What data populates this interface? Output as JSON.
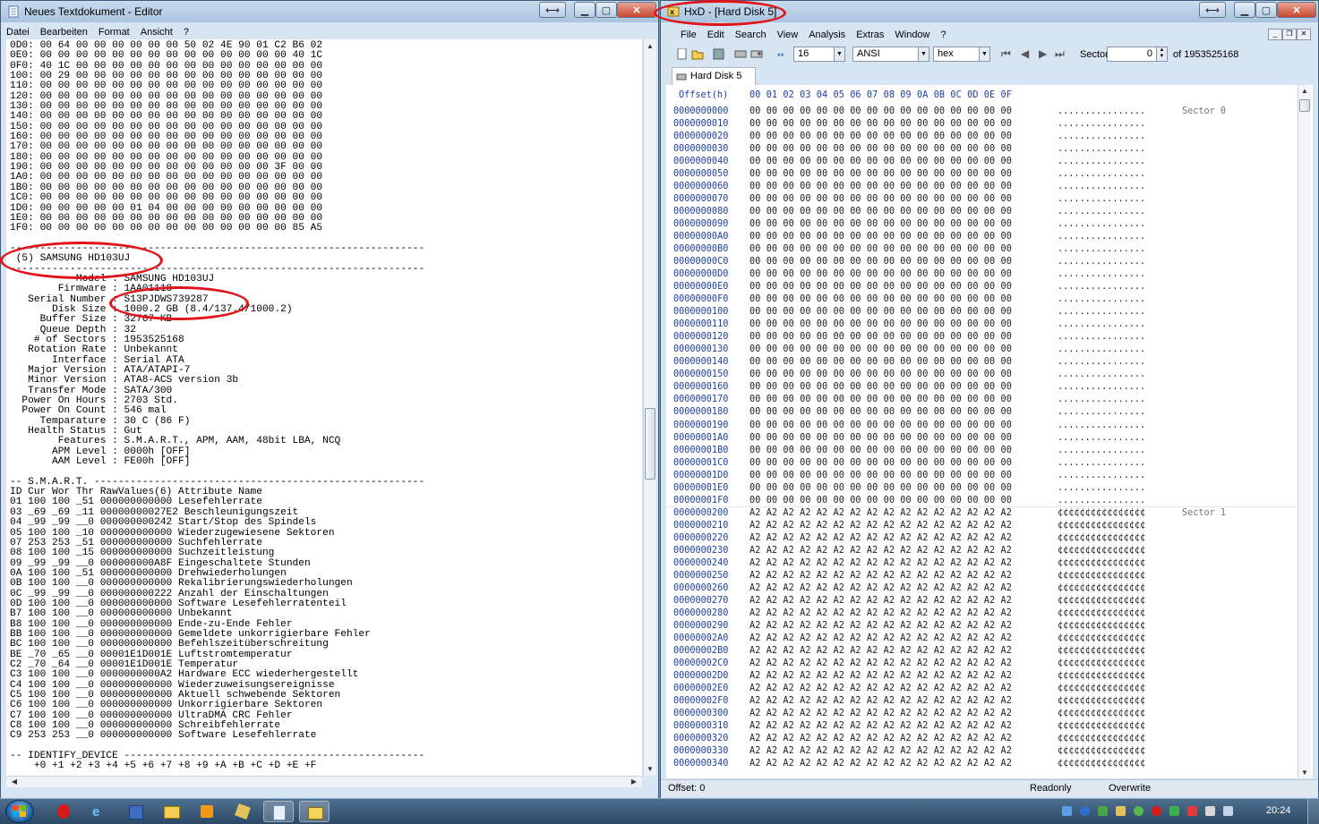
{
  "notepad": {
    "title": "Neues Textdokument - Editor",
    "menu": [
      "Datei",
      "Bearbeiten",
      "Format",
      "Ansicht",
      "?"
    ],
    "content": "0D0: 00 64 00 00 00 00 00 00 50 02 4E 90 01 C2 B6 02\n0E0: 00 00 00 00 00 00 00 00 00 00 00 00 00 00 40 1C\n0F0: 40 1C 00 00 00 00 00 00 00 00 00 00 00 00 00 00\n100: 00 29 00 00 00 00 00 00 00 00 00 00 00 00 00 00\n110: 00 00 00 00 00 00 00 00 00 00 00 00 00 00 00 00\n120: 00 00 00 00 00 00 00 00 00 00 00 00 00 00 00 00\n130: 00 00 00 00 00 00 00 00 00 00 00 00 00 00 00 00\n140: 00 00 00 00 00 00 00 00 00 00 00 00 00 00 00 00\n150: 00 00 00 00 00 00 00 00 00 00 00 00 00 00 00 00\n160: 00 00 00 00 00 00 00 00 00 00 00 00 00 00 00 00\n170: 00 00 00 00 00 00 00 00 00 00 00 00 00 00 00 00\n180: 00 00 00 00 00 00 00 00 00 00 00 00 00 00 00 00\n190: 00 00 00 00 00 00 00 00 00 00 00 00 00 3F 00 00\n1A0: 00 00 00 00 00 00 00 00 00 00 00 00 00 00 00 00\n1B0: 00 00 00 00 00 00 00 00 00 00 00 00 00 00 00 00\n1C0: 00 00 00 00 00 00 00 00 00 00 00 00 00 00 00 00\n1D0: 00 00 00 00 00 01 04 00 00 00 00 00 00 00 00 00\n1E0: 00 00 00 00 00 00 00 00 00 00 00 00 00 00 00 00\n1F0: 00 00 00 00 00 00 00 00 00 00 00 00 00 00 85 A5\n\n---------------------------------------------------------------------\n (5) SAMSUNG HD103UJ\n---------------------------------------------------------------------\n           Model : SAMSUNG HD103UJ\n        Firmware : 1AA01118\n   Serial Number : S13PJDWS739287\n       Disk Size : 1000.2 GB (8.4/137.4/1000.2)\n     Buffer Size : 32767 KB\n     Queue Depth : 32\n    # of Sectors : 1953525168\n   Rotation Rate : Unbekannt\n       Interface : Serial ATA\n   Major Version : ATA/ATAPI-7\n   Minor Version : ATA8-ACS version 3b\n   Transfer Mode : SATA/300\n  Power On Hours : 2703 Std.\n  Power On Count : 546 mal\n     Temparature : 30 C (86 F)\n   Health Status : Gut\n        Features : S.M.A.R.T., APM, AAM, 48bit LBA, NCQ\n       APM Level : 0000h [OFF]\n       AAM Level : FE00h [OFF]\n\n-- S.M.A.R.T. -------------------------------------------------------\nID Cur Wor Thr RawValues(6) Attribute Name\n01 100 100 _51 000000000000 Lesefehlerrate\n03 _69 _69 _11 00000000027E2 Beschleunigungszeit\n04 _99 _99 __0 000000000242 Start/Stop des Spindels\n05 100 100 _10 000000000000 Wiederzugewiesene Sektoren\n07 253 253 _51 000000000000 Suchfehlerrate\n08 100 100 _15 000000000000 Suchzeitleistung\n09 _99 _99 __0 000000000A8F Eingeschaltete Stunden\n0A 100 100 _51 000000000000 Drehwiederholungen\n0B 100 100 __0 000000000000 Rekalibrierungswiederholungen\n0C _99 _99 __0 000000000222 Anzahl der Einschaltungen\n0D 100 100 __0 000000000000 Software Lesefehlerratenteil\nB7 100 100 __0 000000000000 Unbekannt\nB8 100 100 __0 000000000000 Ende-zu-Ende Fehler\nBB 100 100 __0 000000000000 Gemeldete unkorrigierbare Fehler\nBC 100 100 __0 000000000000 Befehlszeitüberschreitung\nBE _70 _65 __0 00001E1D001E Luftstromtemperatur\nC2 _70 _64 __0 00001E1D001E Temperatur\nC3 100 100 __0 0000000000A2 Hardware ECC wiederhergestellt\nC4 100 100 __0 000000000000 Wiederzuweisungsereignisse\nC5 100 100 __0 000000000000 Aktuell schwebende Sektoren\nC6 100 100 __0 000000000000 Unkorrigierbare Sektoren\nC7 100 100 __0 000000000000 UltraDMA CRC Fehler\nC8 100 100 __0 000000000000 Schreibfehlerrate\nC9 253 253 __0 000000000000 Software Lesefehlerrate\n\n-- IDENTIFY_DEVICE --------------------------------------------------\n    +0 +1 +2 +3 +4 +5 +6 +7 +8 +9 +A +B +C +D +E +F"
  },
  "hxd": {
    "title": "HxD - [Hard Disk 5]",
    "menu": [
      "File",
      "Edit",
      "Search",
      "View",
      "Analysis",
      "Extras",
      "Window",
      "?"
    ],
    "toolbar": {
      "bytes_per_row": "16",
      "charset": "ANSI",
      "offset_base": "hex",
      "sector_label": "Sector",
      "sector_value": "0",
      "sector_total": "of 1953525168"
    },
    "tab": "Hard Disk 5",
    "header": {
      "offset": "Offset(h)",
      "columns": "00 01 02 03 04 05 06 07 08 09 0A 0B 0C 0D 0E 0F"
    },
    "sector0_label": "Sector 0",
    "sector1_label": "Sector 1",
    "sector0_offsets": [
      "0000000000",
      "0000000010",
      "0000000020",
      "0000000030",
      "0000000040",
      "0000000050",
      "0000000060",
      "0000000070",
      "0000000080",
      "0000000090",
      "00000000A0",
      "00000000B0",
      "00000000C0",
      "00000000D0",
      "00000000E0",
      "00000000F0",
      "0000000100",
      "0000000110",
      "0000000120",
      "0000000130",
      "0000000140",
      "0000000150",
      "0000000160",
      "0000000170",
      "0000000180",
      "0000000190",
      "00000001A0",
      "00000001B0",
      "00000001C0",
      "00000001D0",
      "00000001E0",
      "00000001F0"
    ],
    "sector1_offsets": [
      "0000000200",
      "0000000210",
      "0000000220",
      "0000000230",
      "0000000240",
      "0000000250",
      "0000000260",
      "0000000270",
      "0000000280",
      "0000000290",
      "00000002A0",
      "00000002B0",
      "00000002C0",
      "00000002D0",
      "00000002E0",
      "00000002F0",
      "0000000300",
      "0000000310",
      "0000000320",
      "0000000330",
      "0000000340"
    ],
    "zero_bytes": "00 00 00 00 00 00 00 00 00 00 00 00 00 00 00 00",
    "zero_text": "................",
    "a2_bytes": "A2 A2 A2 A2 A2 A2 A2 A2 A2 A2 A2 A2 A2 A2 A2 A2",
    "a2_text": "¢¢¢¢¢¢¢¢¢¢¢¢¢¢¢¢",
    "status": {
      "offset": "Offset: 0",
      "mode": "Readonly",
      "write": "Overwrite"
    }
  },
  "taskbar": {
    "clock": "20:24"
  },
  "colors": {
    "highlight_oval": "#e0141a",
    "offset_blue": "#1f3f9f"
  }
}
